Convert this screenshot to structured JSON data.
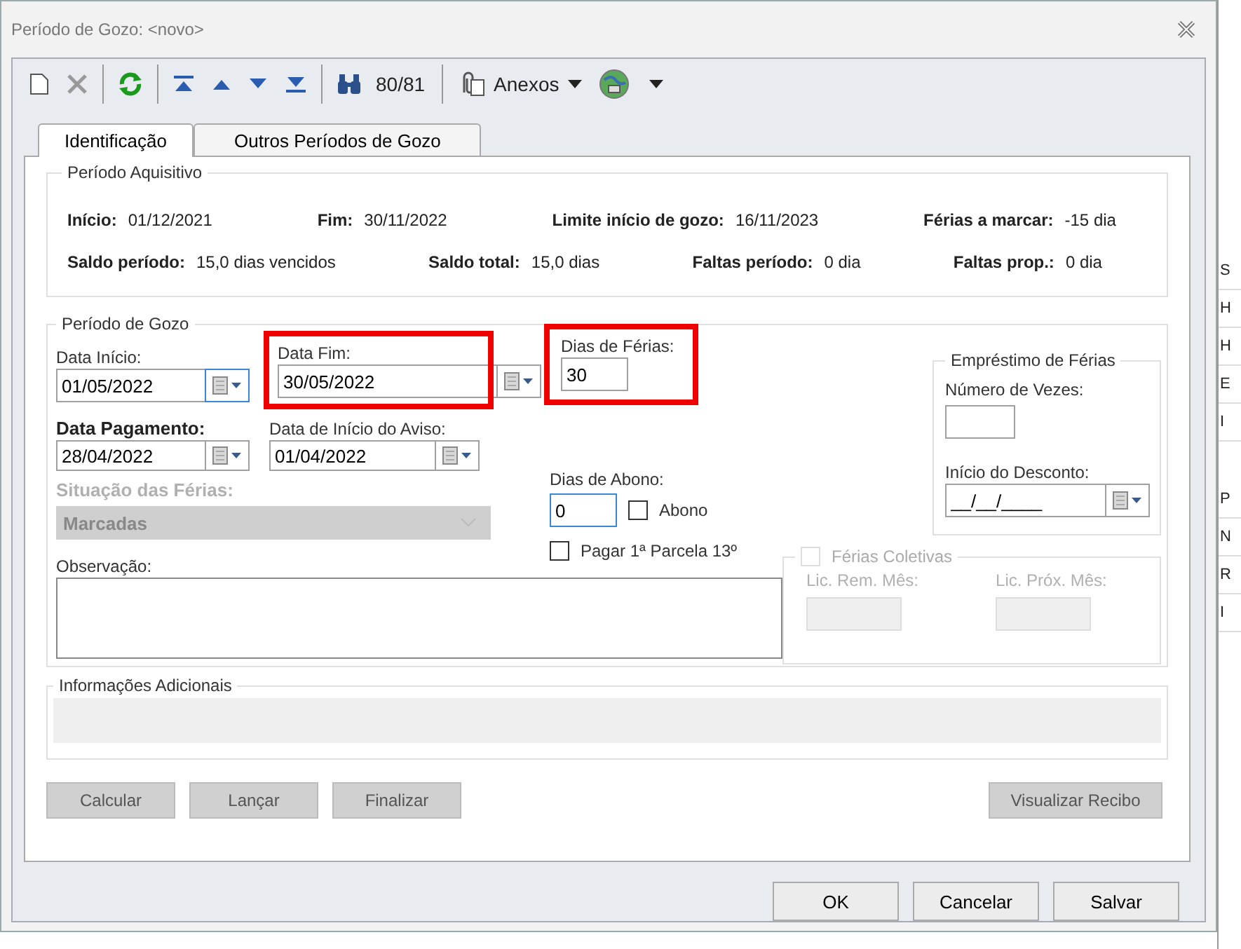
{
  "window": {
    "title": "Período de Gozo: <novo>"
  },
  "toolbar": {
    "record_counter": "80/81",
    "attachments_label": "Anexos"
  },
  "tabs": [
    {
      "label": "Identificação",
      "selected": true
    },
    {
      "label": "Outros Períodos de Gozo",
      "selected": false
    }
  ],
  "periodo_aquisitivo": {
    "title": "Período Aquisitivo",
    "rows": [
      [
        {
          "label": "Início:",
          "value": "01/12/2021"
        },
        {
          "label": "Fim:",
          "value": "30/11/2022"
        },
        {
          "label": "Limite início de gozo:",
          "value": "16/11/2023"
        },
        {
          "label": "Férias a marcar:",
          "value": "-15  dia"
        }
      ],
      [
        {
          "label": "Saldo período:",
          "value": "15,0 dias vencidos"
        },
        {
          "label": "Saldo total:",
          "value": "15,0  dias"
        },
        {
          "label": "Faltas período:",
          "value": "0  dia"
        },
        {
          "label": "Faltas prop.:",
          "value": "0  dia"
        }
      ]
    ]
  },
  "periodo_gozo": {
    "title": "Período de Gozo",
    "data_inicio": {
      "label": "Data Início:",
      "value": "01/05/2022",
      "highlighted": false,
      "focused": true
    },
    "data_fim": {
      "label": "Data Fim:",
      "value": "30/05/2022",
      "highlighted": true,
      "focused": false
    },
    "dias_ferias": {
      "label": "Dias de Férias:",
      "value": "30",
      "highlighted": true
    },
    "data_pagamento": {
      "label": "Data Pagamento:",
      "value": "28/04/2022",
      "highlighted": false,
      "focused": false
    },
    "data_aviso": {
      "label": "Data de Início do Aviso:",
      "value": "01/04/2022",
      "highlighted": false,
      "focused": false
    },
    "situacao": {
      "label": "Situação das Férias:",
      "value": "Marcadas",
      "disabled": true
    },
    "dias_abono": {
      "label": "Dias de Abono:",
      "value": "0",
      "focused": true
    },
    "abono": {
      "label": "Abono",
      "checked": false
    },
    "pagar_parcela": {
      "label": "Pagar 1ª Parcela 13º",
      "checked": false
    },
    "observacao": {
      "label": "Observação:"
    },
    "emprestimo": {
      "title": "Empréstimo de Férias",
      "numero_vezes_label": "Número de Vezes:",
      "inicio_desconto_label": "Início do Desconto:",
      "inicio_desconto_value": "__/__/____"
    },
    "ferias_coletivas": {
      "label": "Férias Coletivas",
      "checked": false,
      "disabled": true,
      "fields": [
        "Lic. Rem. Mês:",
        "Lic. Próx. Mês:"
      ]
    }
  },
  "informacoes_adicionais": {
    "title": "Informações Adicionais"
  },
  "action_buttons": [
    {
      "label": "Calcular",
      "disabled": true
    },
    {
      "label": "Lançar",
      "disabled": true
    },
    {
      "label": "Finalizar",
      "disabled": true
    },
    {
      "label": "Visualizar Recibo",
      "disabled": true
    }
  ],
  "dialog_buttons": [
    "OK",
    "Cancelar",
    "Salvar"
  ],
  "background_fragments": [
    "S",
    "H",
    "H",
    "E",
    "I",
    "P",
    "N",
    "R",
    "I"
  ]
}
